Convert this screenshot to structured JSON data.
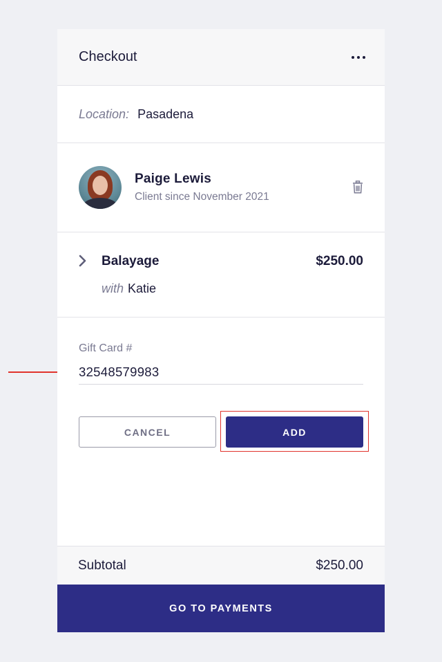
{
  "header": {
    "title": "Checkout",
    "more_icon": "more-horizontal-icon"
  },
  "location": {
    "label": "Location:",
    "value": "Pasadena"
  },
  "client": {
    "name": "Paige Lewis",
    "since": "Client since November 2021",
    "avatar": "avatar-photo",
    "delete_icon": "trash-icon"
  },
  "service": {
    "name": "Balayage",
    "price": "$250.00",
    "with_label": "with",
    "stylist": "Katie",
    "expand_icon": "chevron-right-icon"
  },
  "gift_card": {
    "label": "Gift Card #",
    "value": "32548579983",
    "cancel_label": "CANCEL",
    "add_label": "ADD"
  },
  "summary": {
    "subtotal_label": "Subtotal",
    "subtotal_value": "$250.00"
  },
  "footer": {
    "payments_label": "GO TO PAYMENTS"
  },
  "colors": {
    "accent": "#2d2d86",
    "annotation": "#e0332c",
    "background": "#eff0f4"
  }
}
